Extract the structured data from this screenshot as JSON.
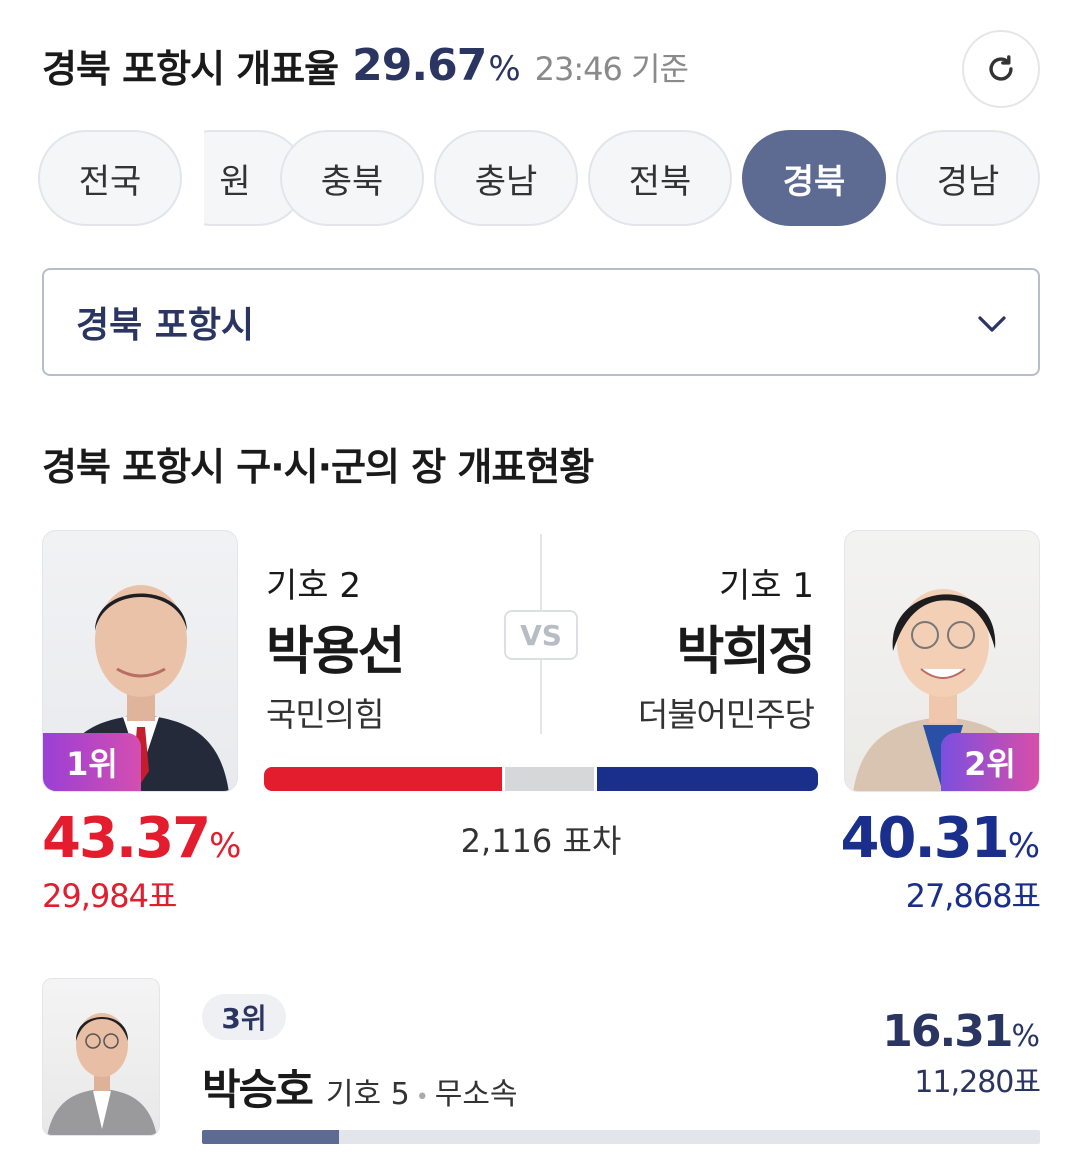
{
  "header": {
    "title": "경북 포항시 개표율",
    "rate": "29.67",
    "rate_unit": "%",
    "time": "23:46 기준"
  },
  "tabs": [
    {
      "label": "전국",
      "active": false
    },
    {
      "label": "원",
      "active": false
    },
    {
      "label": "충북",
      "active": false
    },
    {
      "label": "충남",
      "active": false
    },
    {
      "label": "전북",
      "active": false
    },
    {
      "label": "경북",
      "active": true
    },
    {
      "label": "경남",
      "active": false
    }
  ],
  "select": {
    "value": "경북 포항시"
  },
  "section": {
    "title": "경북 포항시 구·시·군의 장 개표현황"
  },
  "versus": {
    "vs_label": "VS",
    "gap": "2,116 표차",
    "left": {
      "rank": "1위",
      "number": "기호 2",
      "name": "박용선",
      "party": "국민의힘",
      "percent": "43.37",
      "percent_unit": "%",
      "votes": "29,984표",
      "share": 43.37,
      "color": "#e31d2e"
    },
    "right": {
      "rank": "2위",
      "number": "기호 1",
      "name": "박희정",
      "party": "더불어민주당",
      "percent": "40.31",
      "percent_unit": "%",
      "votes": "27,868표",
      "share": 40.31,
      "color": "#1a2e8c"
    }
  },
  "third": {
    "rank": "3위",
    "name": "박승호",
    "number": "기호 5",
    "party": "무소속",
    "percent": "16.31",
    "percent_unit": "%",
    "votes": "11,280표",
    "share": 16.31
  }
}
